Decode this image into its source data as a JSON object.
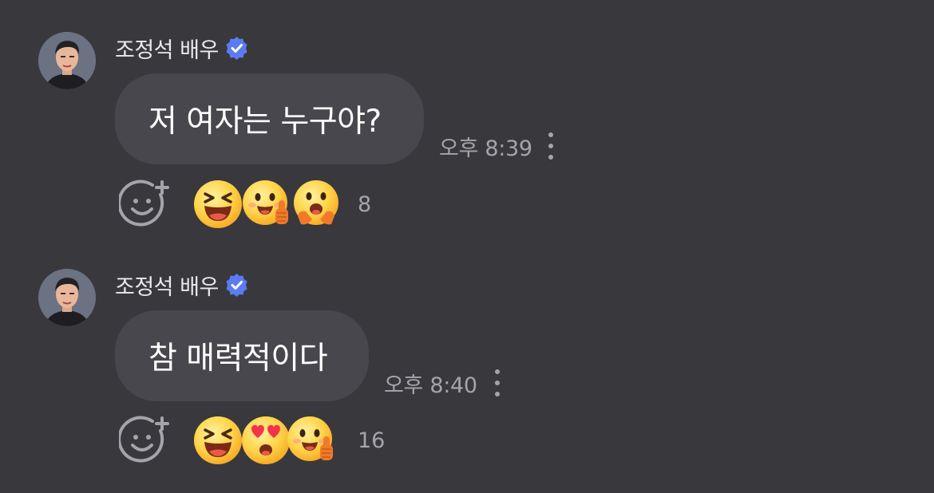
{
  "messages": [
    {
      "sender": "조정석 배우",
      "text": "저 여자는 누구야?",
      "time": "오후 8:39",
      "reactions": [
        "grinning-squint-face",
        "smiling-face-thumbs-up",
        "hugging-face"
      ],
      "reaction_count": "8"
    },
    {
      "sender": "조정석 배우",
      "text": "참 매력적이다",
      "time": "오후 8:40",
      "reactions": [
        "grinning-squint-face",
        "heart-eyes-face",
        "smiling-face-thumbs-up"
      ],
      "reaction_count": "16"
    }
  ],
  "colors": {
    "background": "#39383d",
    "bubble": "#48474d",
    "verified_badge": "#5b7cf0",
    "secondary_text": "#a5a4aa"
  }
}
